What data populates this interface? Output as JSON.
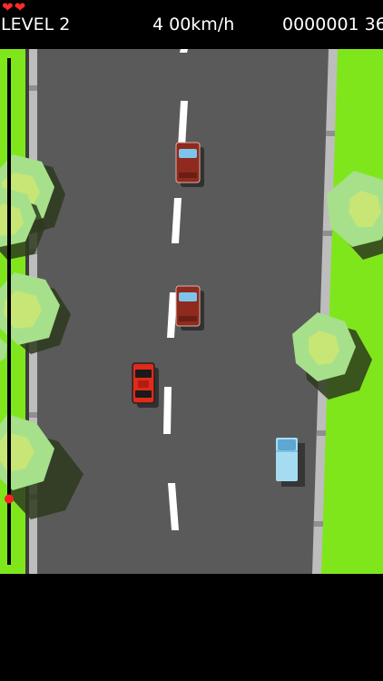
{
  "hud": {
    "hearts": "❤❤",
    "lives": 2,
    "level_label": "LEVEL 2",
    "speed_label": "4 00km/h",
    "score_label": "0000001 36"
  },
  "colors": {
    "grass": "#7fe61c",
    "road": "#5a5a5a",
    "curb": "#b4b4b4",
    "lane_marking": "#ffffff",
    "player_car": "#e02a1a",
    "traffic_car": "#8f2a1e",
    "truck": "#a6dcf2",
    "progress_marker": "#ff2020"
  },
  "progress": {
    "fraction": 0.87
  }
}
